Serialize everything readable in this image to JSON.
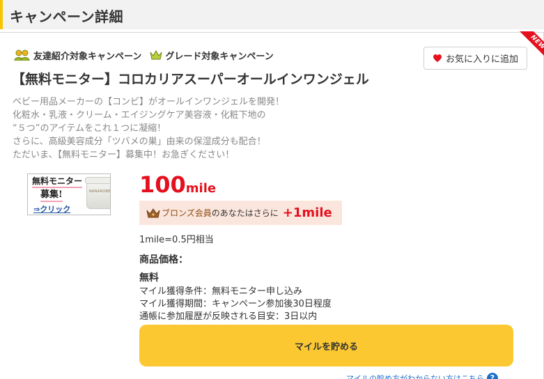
{
  "header": {
    "title": "キャンペーン詳細"
  },
  "ribbon": {
    "label": "NEW"
  },
  "tags": [
    {
      "label": "友達紹介対象キャンペーン",
      "icon": "friends-icon"
    },
    {
      "label": "グレード対象キャンペーン",
      "icon": "crown-icon"
    }
  ],
  "favorite": {
    "label": "お気に入りに追加",
    "icon": "heart-icon"
  },
  "campaign": {
    "title": "【無料モニター】コロカリアスーパーオールインワンジェル",
    "description": [
      "ベビー用品メーカーの【コンビ】がオールインワンジェルを開発！",
      "化粧水・乳液・クリーム・エイジングケア美容液・化粧下地の",
      "“５つ”のアイテムをこれ１つに凝縮！",
      "さらに、高級美容成分「ツバメの巣」由来の保湿成分も配合！",
      "ただいま、【無料モニター】募集中！お急ぎください！"
    ]
  },
  "thumbnail": {
    "title": "無料モニター",
    "subtitle": "募集!",
    "link": "⇒クリック",
    "jar_text": "NANAROBE"
  },
  "reward": {
    "amount": "100",
    "unit": "mile",
    "bonus_rank": "ブロンズ会員",
    "bonus_text": "のあなたはさらに",
    "bonus_amount": "+1mile",
    "rate": "1mile=0.5円相当"
  },
  "price": {
    "label": "商品価格：",
    "value": "無料"
  },
  "conditions": [
    "マイル獲得条件：無料モニター申し込み",
    "マイル獲得期間：キャンペーン参加後30日程度",
    "通帳に参加履歴が反映される目安：3日以内"
  ],
  "earn_button": {
    "label": "マイルを貯める"
  },
  "help_link": {
    "label": "マイルの貯め方がわからない方はこちら",
    "icon_text": "?"
  },
  "colors": {
    "accent": "#f7c600",
    "mile_red": "#e5101d",
    "button_yellow": "#fcc832",
    "bonus_bg": "#fbe6dd"
  }
}
